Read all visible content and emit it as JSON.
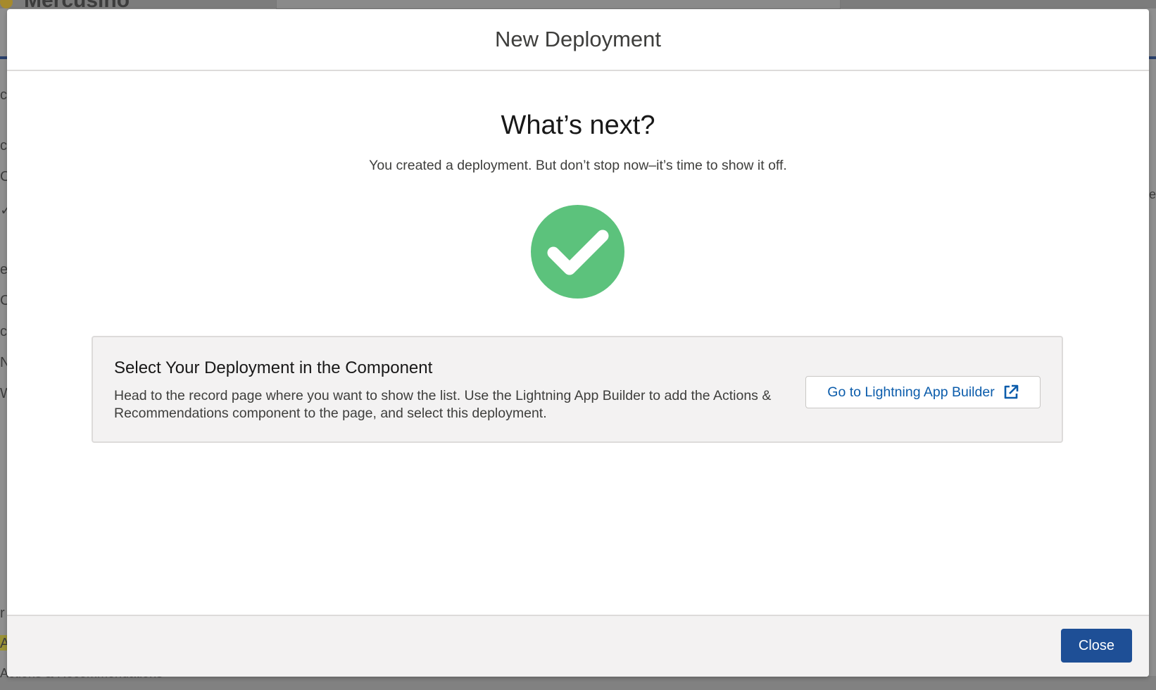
{
  "background": {
    "brand_text": "Mercusino",
    "side_letters": [
      "c",
      "cu",
      "C",
      "✓",
      "e",
      "C",
      "ce",
      "N",
      "W",
      "r",
      "A"
    ],
    "right_letter": "e",
    "bottom_text": "Actions & Recommendations"
  },
  "modal": {
    "title": "New Deployment",
    "heading": "What’s next?",
    "subtitle": "You created a deployment. But don’t stop now–it’s time to show it off.",
    "success_icon": "check-circle-icon",
    "card": {
      "title": "Select Your Deployment in the Component",
      "text": "Head to the record page where you want to show the list. Use the Lightning App Builder to add the Actions & Recommendations component to the page, and select this deployment.",
      "button_label": "Go to Lightning App Builder",
      "button_icon": "external-link-icon"
    },
    "footer": {
      "close_label": "Close"
    }
  },
  "colors": {
    "success": "#5cc27c",
    "brand_button": "#1e4f96",
    "link": "#0b5cab"
  }
}
